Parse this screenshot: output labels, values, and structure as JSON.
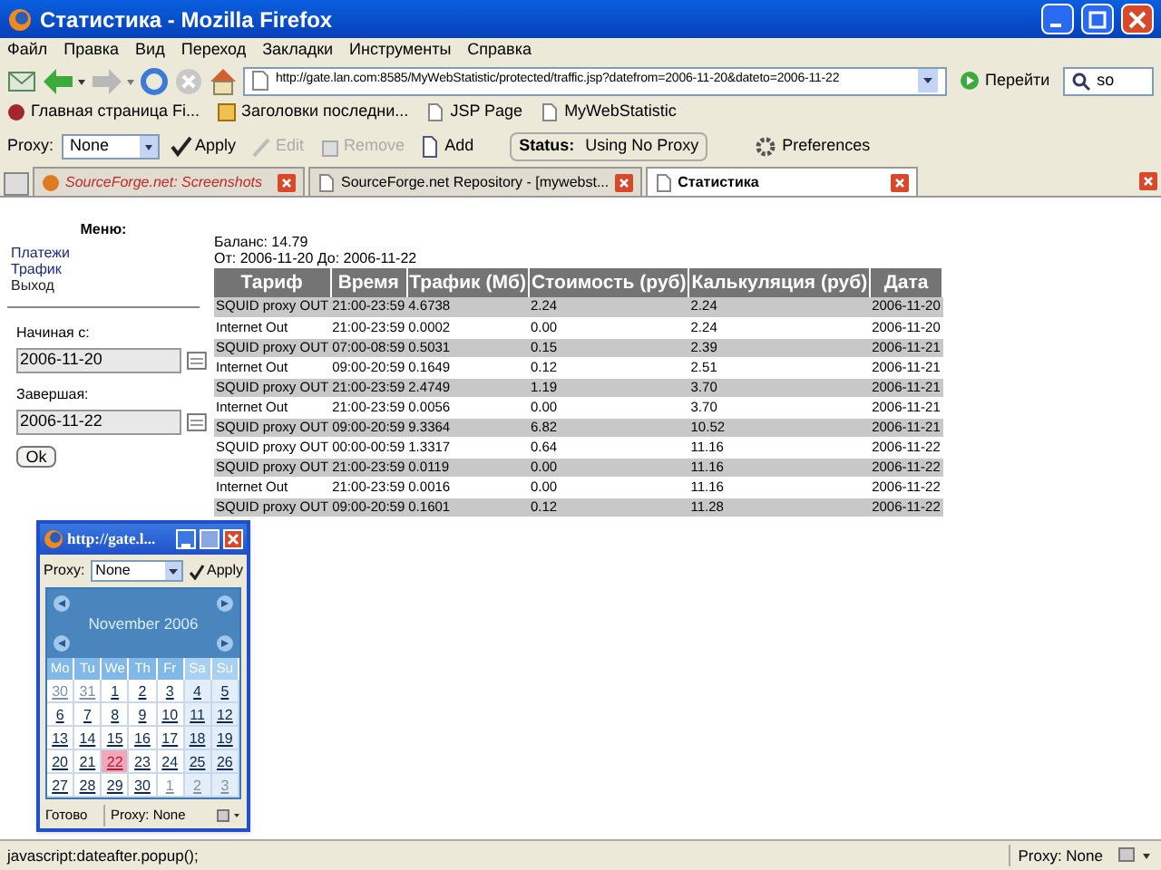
{
  "window": {
    "title": "Статистика - Mozilla Firefox"
  },
  "menu": [
    "Файл",
    "Правка",
    "Вид",
    "Переход",
    "Закладки",
    "Инструменты",
    "Справка"
  ],
  "nav": {
    "url": "http://gate.lan.com:8585/MyWebStatistic/protected/traffic.jsp?datefrom=2006-11-20&dateto=2006-11-22",
    "go": "Перейти",
    "search": "so"
  },
  "bookmarks": [
    "Главная страница Fi...",
    "Заголовки последни...",
    "JSP Page",
    "MyWebStatistic"
  ],
  "proxy_bar": {
    "label": "Proxy:",
    "value": "None",
    "buttons": [
      {
        "label": "Apply",
        "disabled": false
      },
      {
        "label": "Edit",
        "disabled": true
      },
      {
        "label": "Remove",
        "disabled": true
      },
      {
        "label": "Add",
        "disabled": false
      }
    ],
    "status_label": "Status:",
    "status_value": "Using No Proxy",
    "preferences": "Preferences"
  },
  "tabs": [
    {
      "label": "SourceForge.net: Screenshots",
      "selected": false
    },
    {
      "label": "SourceForge.net Repository - [mywebst...",
      "selected": false
    },
    {
      "label": "Статистика",
      "selected": true
    }
  ],
  "sidebar": {
    "title": "Меню:",
    "links": [
      "Платежи",
      "Трафик",
      "Выход"
    ],
    "start_label": "Начиная с:",
    "start_value": "2006-11-20",
    "end_label": "Завершая:",
    "end_value": "2006-11-22",
    "ok": "Ok"
  },
  "info": {
    "balance": "Баланс: 14.79",
    "range": "От: 2006-11-20 До: 2006-11-22"
  },
  "table": {
    "columns": [
      "Тариф",
      "Время",
      "Трафик (Мб)",
      "Стоимость (руб)",
      "Калькуляция (руб)",
      "Дата"
    ],
    "rows": [
      [
        "SQUID proxy OUT",
        "21:00-23:59",
        "4.6738",
        "2.24",
        "2.24",
        "2006-11-20"
      ],
      [
        "Internet Out",
        "21:00-23:59",
        "0.0002",
        "0.00",
        "2.24",
        "2006-11-20"
      ],
      [
        "SQUID proxy OUT",
        "07:00-08:59",
        "0.5031",
        "0.15",
        "2.39",
        "2006-11-21"
      ],
      [
        "Internet Out",
        "09:00-20:59",
        "0.1649",
        "0.12",
        "2.51",
        "2006-11-21"
      ],
      [
        "SQUID proxy OUT",
        "21:00-23:59",
        "2.4749",
        "1.19",
        "3.70",
        "2006-11-21"
      ],
      [
        "Internet Out",
        "21:00-23:59",
        "0.0056",
        "0.00",
        "3.70",
        "2006-11-21"
      ],
      [
        "SQUID proxy OUT",
        "09:00-20:59",
        "9.3364",
        "6.82",
        "10.52",
        "2006-11-21"
      ],
      [
        "SQUID proxy OUT",
        "00:00-00:59",
        "1.3317",
        "0.64",
        "11.16",
        "2006-11-22"
      ],
      [
        "SQUID proxy OUT",
        "21:00-23:59",
        "0.0119",
        "0.00",
        "11.16",
        "2006-11-22"
      ],
      [
        "Internet Out",
        "21:00-23:59",
        "0.0016",
        "0.00",
        "11.16",
        "2006-11-22"
      ],
      [
        "SQUID proxy OUT",
        "09:00-20:59",
        "0.1601",
        "0.12",
        "11.28",
        "2006-11-22"
      ]
    ]
  },
  "popup": {
    "title": "http://gate.l...",
    "proxy_label": "Proxy:",
    "proxy_value": "None",
    "apply": "Apply",
    "month": "November 2006",
    "weekdays": [
      "Mo",
      "Tu",
      "We",
      "Th",
      "Fr",
      "Sa",
      "Su"
    ],
    "days": [
      {
        "label": "30",
        "muted": true,
        "selected": false
      },
      {
        "label": "31",
        "muted": true,
        "selected": false
      },
      {
        "label": "1",
        "muted": false,
        "selected": false
      },
      {
        "label": "2",
        "muted": false,
        "selected": false
      },
      {
        "label": "3",
        "muted": false,
        "selected": false
      },
      {
        "label": "4",
        "muted": false,
        "selected": false
      },
      {
        "label": "5",
        "muted": false,
        "selected": false
      },
      {
        "label": "6",
        "muted": false,
        "selected": false
      },
      {
        "label": "7",
        "muted": false,
        "selected": false
      },
      {
        "label": "8",
        "muted": false,
        "selected": false
      },
      {
        "label": "9",
        "muted": false,
        "selected": false
      },
      {
        "label": "10",
        "muted": false,
        "selected": false
      },
      {
        "label": "11",
        "muted": false,
        "selected": false
      },
      {
        "label": "12",
        "muted": false,
        "selected": false
      },
      {
        "label": "13",
        "muted": false,
        "selected": false
      },
      {
        "label": "14",
        "muted": false,
        "selected": false
      },
      {
        "label": "15",
        "muted": false,
        "selected": false
      },
      {
        "label": "16",
        "muted": false,
        "selected": false
      },
      {
        "label": "17",
        "muted": false,
        "selected": false
      },
      {
        "label": "18",
        "muted": false,
        "selected": false
      },
      {
        "label": "19",
        "muted": false,
        "selected": false
      },
      {
        "label": "20",
        "muted": false,
        "selected": false
      },
      {
        "label": "21",
        "muted": false,
        "selected": false
      },
      {
        "label": "22",
        "muted": false,
        "selected": true
      },
      {
        "label": "23",
        "muted": false,
        "selected": false
      },
      {
        "label": "24",
        "muted": false,
        "selected": false
      },
      {
        "label": "25",
        "muted": false,
        "selected": false
      },
      {
        "label": "26",
        "muted": false,
        "selected": false
      },
      {
        "label": "27",
        "muted": false,
        "selected": false
      },
      {
        "label": "28",
        "muted": false,
        "selected": false
      },
      {
        "label": "29",
        "muted": false,
        "selected": false
      },
      {
        "label": "30",
        "muted": false,
        "selected": false
      },
      {
        "label": "1",
        "muted": true,
        "selected": false
      },
      {
        "label": "2",
        "muted": true,
        "selected": false
      },
      {
        "label": "3",
        "muted": true,
        "selected": false
      }
    ],
    "status": "Готово",
    "status_proxy": "Proxy: None"
  },
  "status_bar": {
    "text": "javascript:dateafter.popup();",
    "proxy": "Proxy: None"
  }
}
